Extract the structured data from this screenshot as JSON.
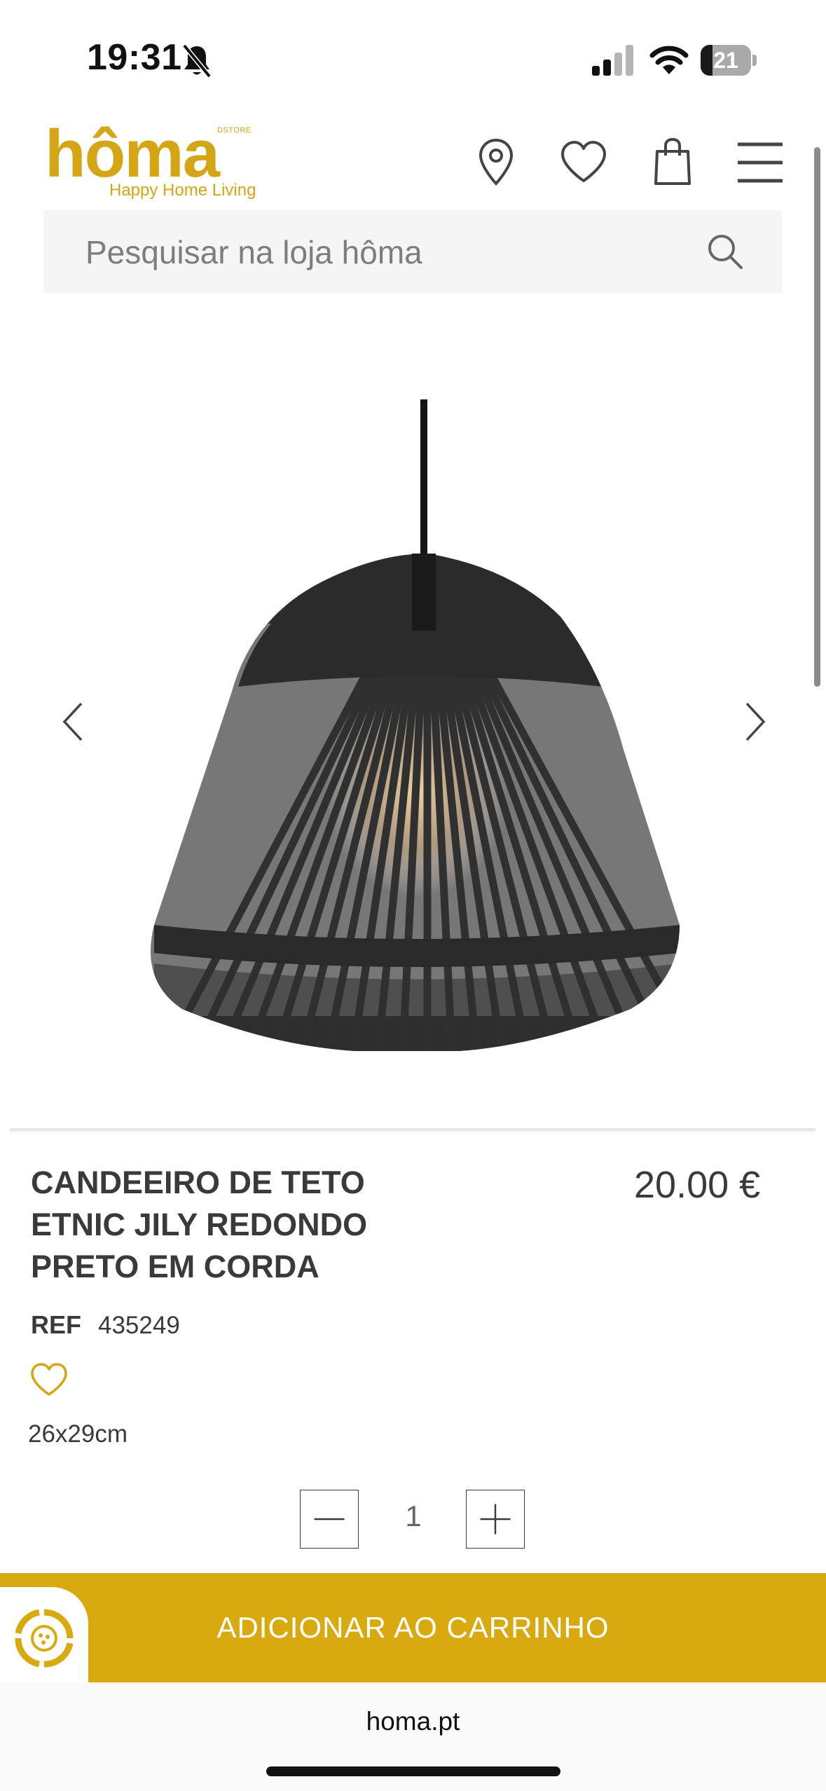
{
  "status_bar": {
    "time": "19:31",
    "battery_level": "21",
    "icons": [
      "bell-muted-icon",
      "signal-icon",
      "wifi-icon",
      "battery-icon"
    ]
  },
  "header": {
    "logo": {
      "word": "hôma",
      "store": "DSTORE",
      "tagline": "Happy Home Living"
    },
    "icons": [
      "location-pin-icon",
      "heart-icon",
      "shopping-bag-icon",
      "menu-icon"
    ]
  },
  "search": {
    "placeholder": "Pesquisar na loja hôma"
  },
  "gallery": {
    "image": "black-rope-pendant-lamp",
    "icons": [
      "chevron-left-icon",
      "chevron-right-icon"
    ]
  },
  "product": {
    "title": "CANDEEIRO DE TETO ETNIC JILY REDONDO PRETO EM CORDA",
    "price": "20.00 €",
    "ref_label": "REF",
    "ref_value": "435249",
    "dimensions": "26x29cm"
  },
  "quantity": {
    "value": "1"
  },
  "cart": {
    "label": "ADICIONAR AO CARRINHO"
  },
  "browser": {
    "url": "homa.pt"
  },
  "colors": {
    "brand": "#d4a514",
    "cart_bar": "#d9aa0f",
    "text": "#3a3a3a"
  }
}
